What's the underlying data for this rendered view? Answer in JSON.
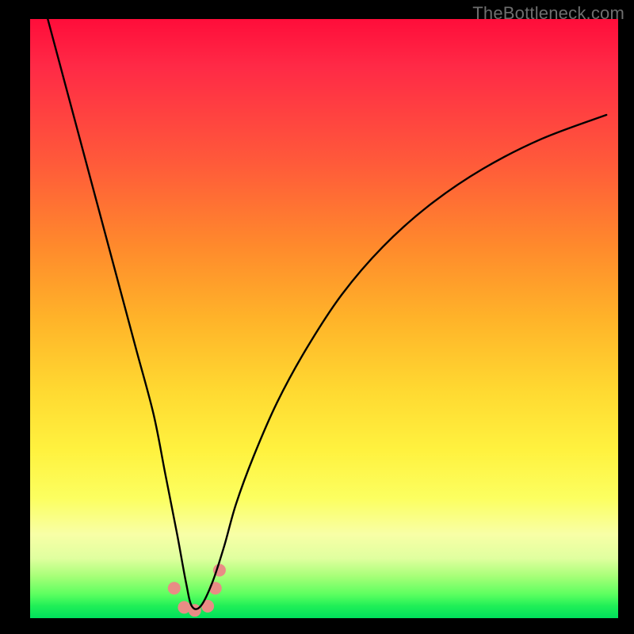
{
  "watermark": "TheBottleneck.com",
  "colors": {
    "frame": "#000000",
    "curve": "#000000",
    "marker_fill": "#e98c85",
    "marker_stroke": "#e98c85"
  },
  "chart_data": {
    "type": "line",
    "title": "",
    "xlabel": "",
    "ylabel": "",
    "xlim": [
      0,
      100
    ],
    "ylim": [
      0,
      100
    ],
    "grid": false,
    "legend": false,
    "annotations": [],
    "series": [
      {
        "name": "bottleneck-curve",
        "color": "#000000",
        "x": [
          3,
          6,
          9,
          12,
          15,
          18,
          21,
          23,
          25,
          26.5,
          27.5,
          29,
          31,
          33,
          35,
          38,
          42,
          47,
          53,
          60,
          68,
          77,
          87,
          98
        ],
        "values": [
          100,
          89,
          78,
          67,
          56,
          45,
          34,
          24,
          14,
          6,
          2,
          2,
          6,
          12,
          19,
          27,
          36,
          45,
          54,
          62,
          69,
          75,
          80,
          84
        ]
      }
    ],
    "markers": {
      "name": "highlight-points",
      "color": "#e98c85",
      "radius_px": 8,
      "x": [
        24.5,
        26.2,
        28.0,
        30.2,
        31.5,
        32.2
      ],
      "values": [
        5.0,
        1.8,
        1.3,
        2.0,
        5.0,
        8.0
      ]
    }
  }
}
